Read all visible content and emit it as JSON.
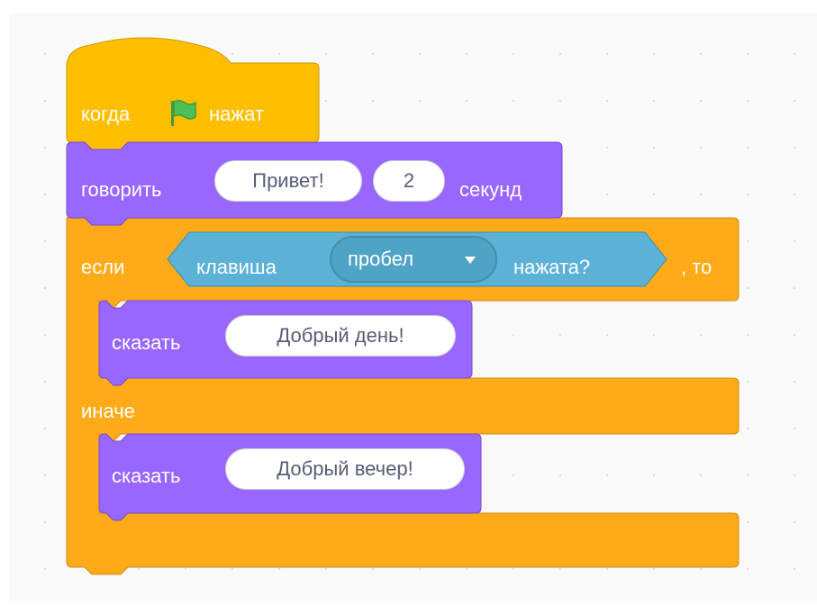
{
  "script": {
    "hat": {
      "before": "когда",
      "flag_icon": "green-flag-icon",
      "after": "нажат"
    },
    "say_for": {
      "label": "говорить",
      "message": "Привет!",
      "seconds": "2",
      "unit": "секунд"
    },
    "if_else": {
      "if_label": "если",
      "condition": {
        "label": "клавиша",
        "key": "пробел",
        "suffix": "нажата?"
      },
      "then_label": ", то",
      "then_say": {
        "label": "сказать",
        "message": "Добрый день!"
      },
      "else_label": "иначе",
      "else_say": {
        "label": "сказать",
        "message": "Добрый вечер!"
      }
    }
  },
  "colors": {
    "events": "#ffbf00",
    "looks": "#9966ff",
    "control": "#ffab19",
    "sensing": "#5cb1d6",
    "workspace": "#f9f9f9"
  }
}
